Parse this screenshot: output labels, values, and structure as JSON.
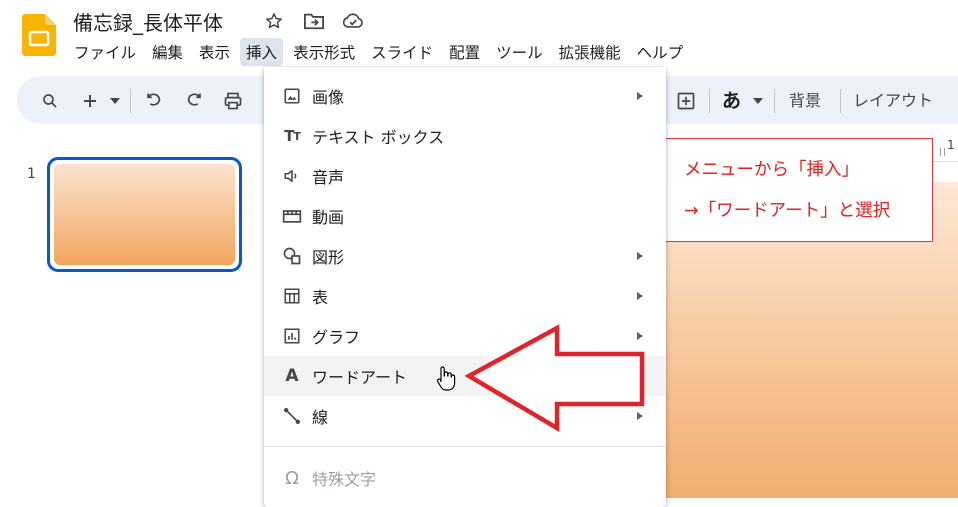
{
  "app": {
    "doc_title": "備忘録_長体平体",
    "title_icons": [
      "star-icon",
      "move-to-folder-icon",
      "cloud-saved-icon"
    ]
  },
  "menubar": {
    "items": [
      "ファイル",
      "編集",
      "表示",
      "挿入",
      "表示形式",
      "スライド",
      "配置",
      "ツール",
      "拡張機能",
      "ヘルプ"
    ],
    "active": "挿入"
  },
  "toolbar": {
    "icons": [
      "search-icon",
      "new-slide-plus-icon",
      "undo-icon",
      "redo-icon",
      "print-icon",
      "add-comment-icon",
      "text-style-icon"
    ],
    "text_style_glyph": "あ",
    "background_label": "背景",
    "layout_label": "レイアウト"
  },
  "filmstrip": {
    "slide_number": "1"
  },
  "ruler": {
    "label": "1"
  },
  "insert_menu": {
    "items": [
      {
        "label": "画像",
        "icon": "image-icon",
        "submenu": true
      },
      {
        "label": "テキスト ボックス",
        "icon": "text-box-icon",
        "submenu": false
      },
      {
        "label": "音声",
        "icon": "audio-icon",
        "submenu": false
      },
      {
        "label": "動画",
        "icon": "video-icon",
        "submenu": false
      },
      {
        "label": "図形",
        "icon": "shape-icon",
        "submenu": true
      },
      {
        "label": "表",
        "icon": "table-icon",
        "submenu": true
      },
      {
        "label": "グラフ",
        "icon": "chart-icon",
        "submenu": true
      },
      {
        "label": "ワードアート",
        "icon": "word-art-icon",
        "submenu": false,
        "highlighted": true
      },
      {
        "label": "線",
        "icon": "line-icon",
        "submenu": true
      },
      {
        "label": "特殊文字",
        "icon": "special-characters-icon",
        "submenu": false,
        "disabled": true
      }
    ]
  },
  "callout": {
    "line1": "メニューから「挿入」",
    "line2": "→「ワードアート」と選択",
    "color": "#e02020"
  },
  "colors": {
    "accent_blue": "#0b57d0",
    "toolbar_bg": "#edf2fa",
    "annotation_red": "#e02020"
  }
}
